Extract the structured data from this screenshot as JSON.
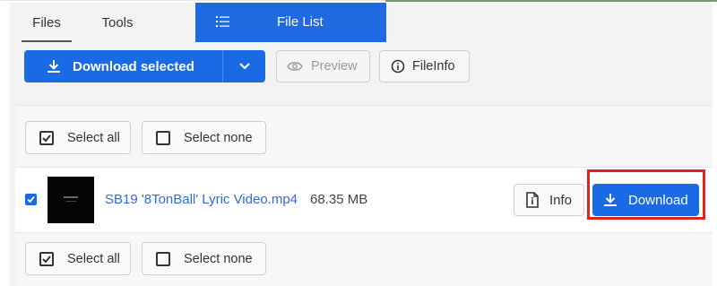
{
  "tabs": {
    "files": "Files",
    "tools": "Tools",
    "file_list": "File List",
    "file_list_icon": "list-icon"
  },
  "toolbar": {
    "download_selected": "Download selected",
    "preview": "Preview",
    "fileinfo": "FileInfo"
  },
  "selection": {
    "select_all": "Select all",
    "select_none": "Select none"
  },
  "file": {
    "name": "SB19 '8TonBall' Lyric Video.mp4",
    "size": "68.35 MB",
    "checked": true,
    "info_label": "Info",
    "download_label": "Download"
  },
  "colors": {
    "accent": "#1a6ae6",
    "highlight": "#e0241c",
    "link": "#2e6bd8"
  }
}
